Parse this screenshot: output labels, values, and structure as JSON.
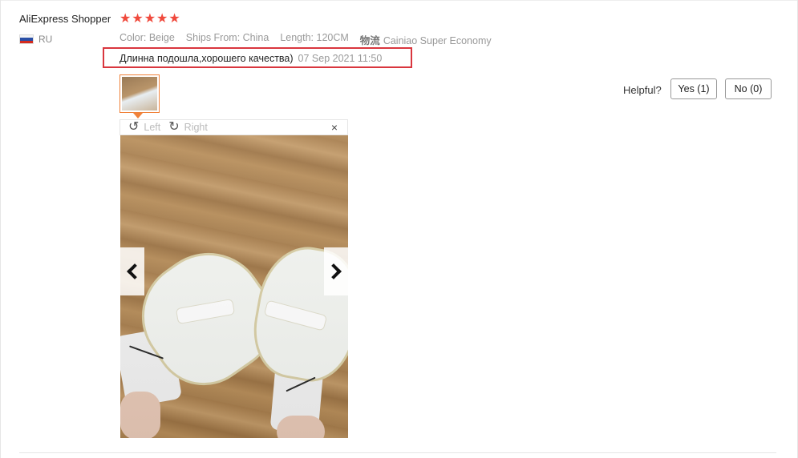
{
  "reviewer": {
    "name": "AliExpress Shopper",
    "country_code": "RU",
    "rating": 5
  },
  "attributes": {
    "color": "Color: Beige",
    "ships_from": "Ships From: China",
    "length": "Length: 120CM",
    "logistics_label": "物流",
    "logistics_value": "Cainiao Super Economy"
  },
  "review": {
    "text": "Длинна подошла,хорошего качества)",
    "date": "07 Sep 2021 11:50"
  },
  "viewer": {
    "rotate_left": "Left",
    "rotate_right": "Right",
    "close_glyph": "×"
  },
  "helpful": {
    "label": "Helpful?",
    "yes": "Yes (1)",
    "no": "No (0)"
  },
  "colors": {
    "star": "#f04a3d",
    "highlight": "#d9363e",
    "thumb_border": "#f0823a"
  },
  "icons": {
    "rotate_left": "rotate-left-icon",
    "rotate_right": "rotate-right-icon",
    "close": "close-icon",
    "prev": "chevron-left-icon",
    "next": "chevron-right-icon"
  }
}
